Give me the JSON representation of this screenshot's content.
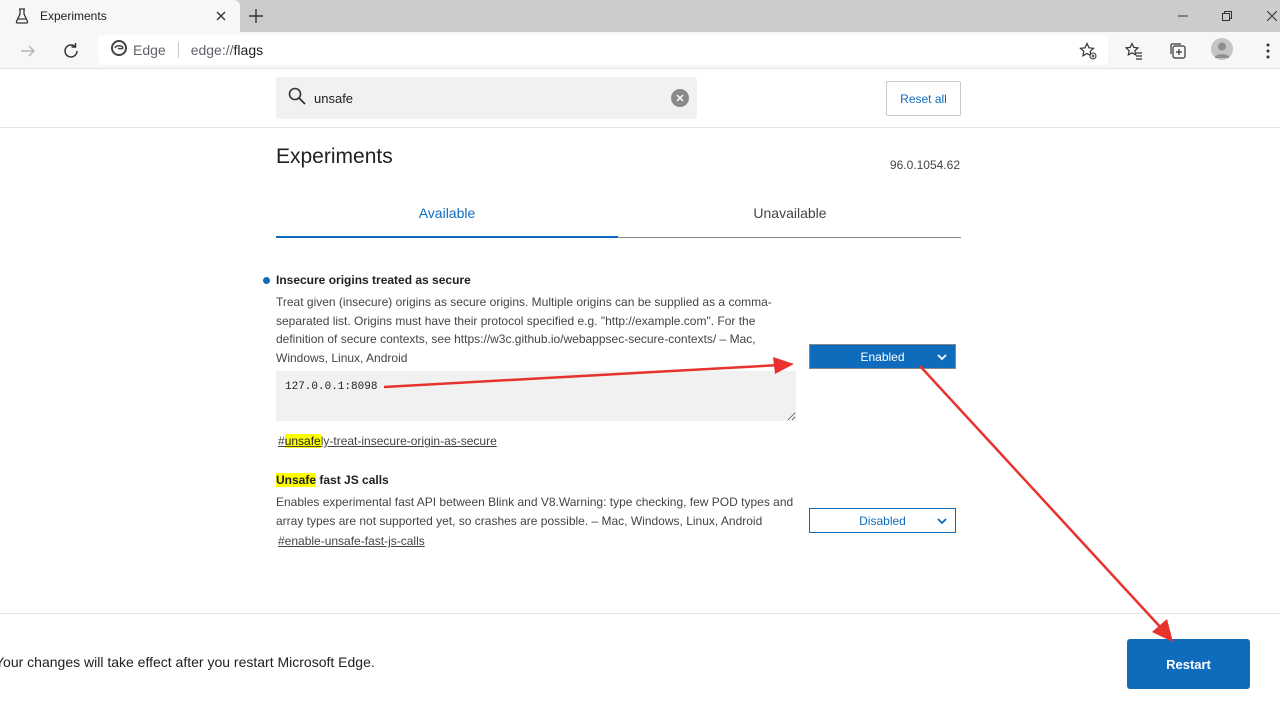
{
  "browser": {
    "tab_title": "Experiments",
    "brand": "Edge",
    "url_scheme": "edge://",
    "url_path": "flags"
  },
  "search": {
    "value": "unsafe",
    "reset_label": "Reset all"
  },
  "main": {
    "title": "Experiments",
    "version": "96.0.1054.62",
    "tabs": [
      {
        "label": "Available",
        "active": true
      },
      {
        "label": "Unavailable",
        "active": false
      }
    ]
  },
  "experiments": [
    {
      "title": "Insecure origins treated as secure",
      "description": "Treat given (insecure) origins as secure origins. Multiple origins can be supplied as a comma-separated list. Origins must have their protocol specified e.g. \"http://example.com\". For the definition of secure contexts, see https://w3c.github.io/webappsec-secure-contexts/ – Mac, Windows, Linux, Android",
      "textarea_value": "127.0.0.1:8098",
      "link_prefix": "#",
      "link_highlight": "unsafe",
      "link_rest": "ly-treat-insecure-origin-as-secure",
      "select_value": "Enabled"
    },
    {
      "title_highlight": "Unsafe",
      "title_rest": " fast JS calls",
      "description": "Enables experimental fast API between Blink and V8.Warning: type checking, few POD types and array types are not supported yet, so crashes are possible. – Mac, Windows, Linux, Android",
      "link": "#enable-unsafe-fast-js-calls",
      "select_value": "Disabled"
    }
  ],
  "footer": {
    "message": "Your changes will take effect after you restart Microsoft Edge.",
    "restart_label": "Restart"
  },
  "colors": {
    "accent": "#0f6cbd",
    "highlight": "#ffff00",
    "annotation": "#e8322d"
  }
}
